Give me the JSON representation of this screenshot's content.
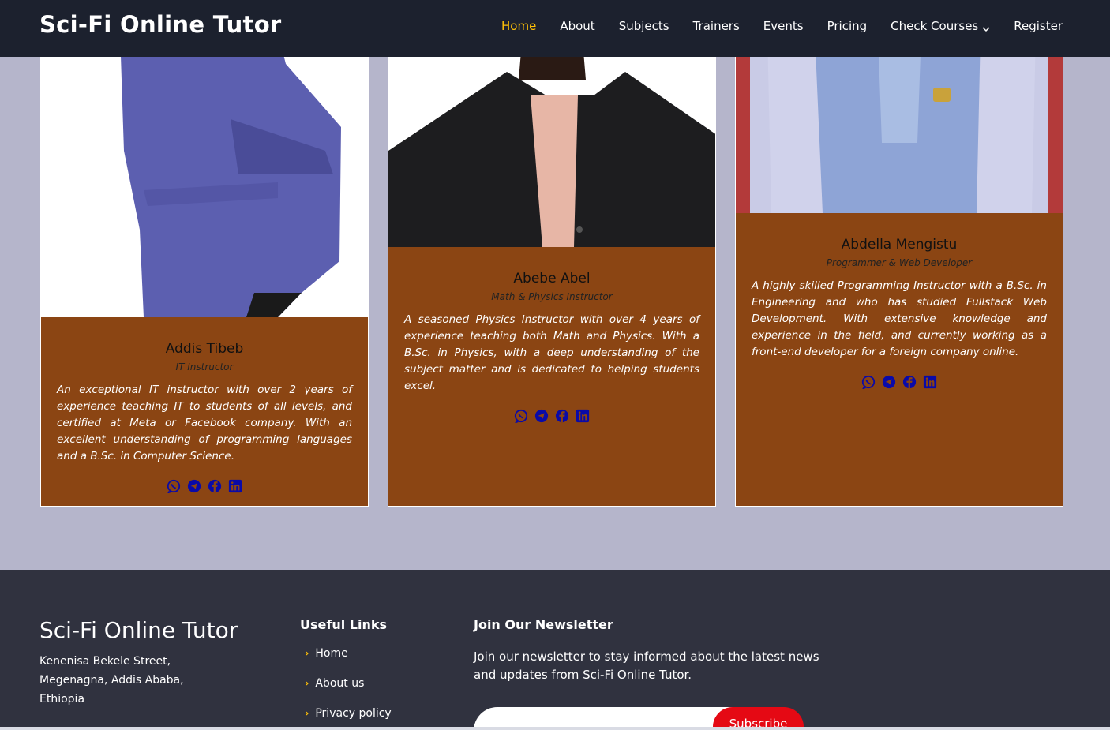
{
  "header": {
    "logo": "Sci-Fi Online Tutor",
    "nav": [
      {
        "label": "Home",
        "active": true
      },
      {
        "label": "About"
      },
      {
        "label": "Subjects"
      },
      {
        "label": "Trainers"
      },
      {
        "label": "Events"
      },
      {
        "label": "Pricing"
      },
      {
        "label": "Check Courses",
        "dropdown": true
      },
      {
        "label": "Register"
      }
    ]
  },
  "trainers": [
    {
      "name": "Addis Tibeb",
      "role": "IT Instructor",
      "bio": "An exceptional IT instructor with over 2 years of experience teaching IT to students of all levels, and certified at Meta or Facebook company. With an excellent understanding of programming languages and a B.Sc. in Computer Science.",
      "socials": [
        "whatsapp-icon",
        "telegram-icon",
        "facebook-icon",
        "linkedin-icon"
      ]
    },
    {
      "name": "Abebe Abel",
      "role": "Math & Physics Instructor",
      "bio": "A seasoned Physics Instructor with over 4 years of experience teaching both Math and Physics. With a B.Sc. in Physics, with a deep understanding of the subject matter and is dedicated to helping students excel.",
      "socials": [
        "whatsapp-icon",
        "telegram-icon",
        "facebook-icon",
        "linkedin-icon"
      ]
    },
    {
      "name": "Abdella Mengistu",
      "role": "Programmer & Web Developer",
      "bio": "A highly skilled Programming Instructor with a B.Sc. in Engineering and who has studied Fullstack Web Development. With extensive knowledge and experience in the field, and currently working as a front-end developer for a foreign company online.",
      "socials": [
        "whatsapp-icon",
        "telegram-icon",
        "facebook-icon",
        "linkedin-icon"
      ]
    }
  ],
  "footer": {
    "brand": "Sci-Fi Online Tutor",
    "address": [
      "Kenenisa Bekele Street,",
      "Megenagna, Addis Ababa,",
      "Ethiopia"
    ],
    "links_title": "Useful Links",
    "links": [
      "Home",
      "About us",
      "Privacy policy"
    ],
    "newsletter_title": "Join Our Newsletter",
    "newsletter_text": "Join our newsletter to stay informed about the latest news and updates from Sci-Fi Online Tutor.",
    "subscribe_label": "Subscribe"
  },
  "colors": {
    "header_bg": "#1c212e",
    "active_nav": "#ffc107",
    "card_bg": "#8b4513",
    "page_bg": "#b5b5cb",
    "footer_bg": "#30323f",
    "subscribe_bg": "#e50914",
    "social_icon": "#0a0aa8"
  }
}
